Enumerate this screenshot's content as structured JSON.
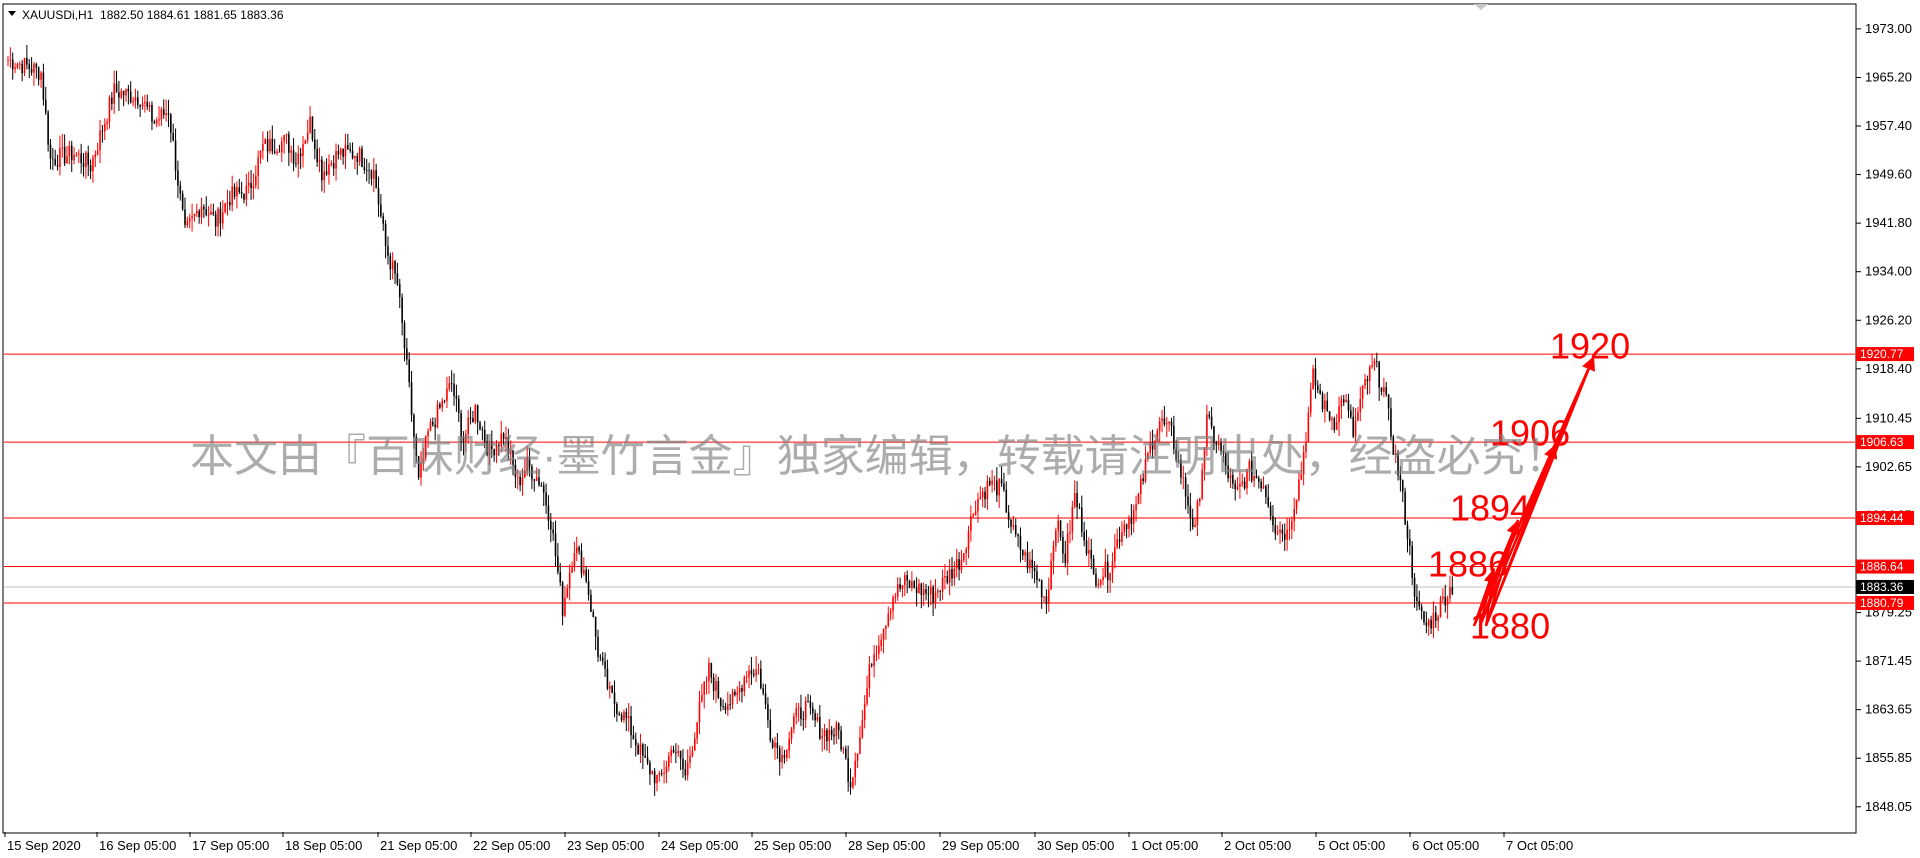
{
  "header": {
    "symbol_info": "XAUUSDi,H1  1882.50 1884.61 1881.65 1883.36",
    "dropdown_icon": "triangle-down-icon"
  },
  "watermark": "本文由『百味财经·墨竹言金』独家编辑，转载请注明出处，经盗必究！",
  "colors": {
    "bull_candle": "#ff0000",
    "bear_candle": "#000000",
    "level_line": "#ff0000",
    "annotation": "#ff0000",
    "price_tag": "#000000"
  },
  "chart_data": {
    "type": "candlestick",
    "timeframe": "H1",
    "ylim": [
      1844.0,
      1977.0
    ],
    "y_ticks": [
      "1973.00",
      "1965.20",
      "1957.40",
      "1949.60",
      "1941.80",
      "1934.00",
      "1926.20",
      "1918.40",
      "1910.45",
      "1902.65",
      "1894.85",
      "1879.25",
      "1871.45",
      "1863.65",
      "1855.85",
      "1848.05"
    ],
    "x_labels": [
      "15 Sep 2020",
      "16 Sep 05:00",
      "17 Sep 05:00",
      "18 Sep 05:00",
      "21 Sep 05:00",
      "22 Sep 05:00",
      "23 Sep 05:00",
      "24 Sep 05:00",
      "25 Sep 05:00",
      "28 Sep 05:00",
      "29 Sep 05:00",
      "30 Sep 05:00",
      "1 Oct 05:00",
      "2 Oct 05:00",
      "5 Oct 05:00",
      "6 Oct 05:00",
      "7 Oct 05:00"
    ],
    "current_price": "1883.36",
    "levels": [
      "1920.77",
      "1906.63",
      "1894.44",
      "1886.64",
      "1880.79"
    ],
    "annotations": [
      {
        "text": "1920",
        "price": 1922
      },
      {
        "text": "1906",
        "price": 1908
      },
      {
        "text": "1894",
        "price": 1896
      },
      {
        "text": "1886",
        "price": 1887
      },
      {
        "text": "1880",
        "price": 1877
      }
    ],
    "projection_arrows": [
      {
        "from_price": 1880.0,
        "to_price": 1920.77
      },
      {
        "from_price": 1880.0,
        "to_price": 1906.63
      },
      {
        "from_price": 1880.0,
        "to_price": 1894.44
      },
      {
        "from_price": 1880.0,
        "to_price": 1886.64
      }
    ],
    "keypoints": [
      {
        "t": 0,
        "p": 1968
      },
      {
        "t": 8,
        "p": 1967
      },
      {
        "t": 14,
        "p": 1966
      },
      {
        "t": 18,
        "p": 1952
      },
      {
        "t": 28,
        "p": 1953
      },
      {
        "t": 35,
        "p": 1951
      },
      {
        "t": 45,
        "p": 1963
      },
      {
        "t": 56,
        "p": 1962
      },
      {
        "t": 62,
        "p": 1958
      },
      {
        "t": 68,
        "p": 1960
      },
      {
        "t": 75,
        "p": 1940
      },
      {
        "t": 82,
        "p": 1945
      },
      {
        "t": 88,
        "p": 1942
      },
      {
        "t": 94,
        "p": 1946
      },
      {
        "t": 102,
        "p": 1947
      },
      {
        "t": 108,
        "p": 1954
      },
      {
        "t": 118,
        "p": 1955
      },
      {
        "t": 122,
        "p": 1952
      },
      {
        "t": 128,
        "p": 1958
      },
      {
        "t": 133,
        "p": 1950
      },
      {
        "t": 140,
        "p": 1953
      },
      {
        "t": 148,
        "p": 1953
      },
      {
        "t": 155,
        "p": 1950
      },
      {
        "t": 160,
        "p": 1938
      },
      {
        "t": 165,
        "p": 1932
      },
      {
        "t": 170,
        "p": 1915
      },
      {
        "t": 174,
        "p": 1900
      },
      {
        "t": 178,
        "p": 1908
      },
      {
        "t": 183,
        "p": 1912
      },
      {
        "t": 188,
        "p": 1916
      },
      {
        "t": 193,
        "p": 1907
      },
      {
        "t": 198,
        "p": 1912
      },
      {
        "t": 204,
        "p": 1905
      },
      {
        "t": 210,
        "p": 1908
      },
      {
        "t": 216,
        "p": 1900
      },
      {
        "t": 220,
        "p": 1903
      },
      {
        "t": 226,
        "p": 1900
      },
      {
        "t": 230,
        "p": 1894
      },
      {
        "t": 235,
        "p": 1880
      },
      {
        "t": 240,
        "p": 1890
      },
      {
        "t": 245,
        "p": 1885
      },
      {
        "t": 250,
        "p": 1873
      },
      {
        "t": 255,
        "p": 1866
      },
      {
        "t": 262,
        "p": 1862
      },
      {
        "t": 270,
        "p": 1855
      },
      {
        "t": 276,
        "p": 1852
      },
      {
        "t": 282,
        "p": 1858
      },
      {
        "t": 287,
        "p": 1853
      },
      {
        "t": 292,
        "p": 1862
      },
      {
        "t": 297,
        "p": 1870
      },
      {
        "t": 302,
        "p": 1865
      },
      {
        "t": 308,
        "p": 1865
      },
      {
        "t": 313,
        "p": 1870
      },
      {
        "t": 318,
        "p": 1870
      },
      {
        "t": 323,
        "p": 1860
      },
      {
        "t": 328,
        "p": 1856
      },
      {
        "t": 333,
        "p": 1862
      },
      {
        "t": 338,
        "p": 1864
      },
      {
        "t": 345,
        "p": 1860
      },
      {
        "t": 352,
        "p": 1860
      },
      {
        "t": 357,
        "p": 1852
      },
      {
        "t": 362,
        "p": 1862
      },
      {
        "t": 366,
        "p": 1872
      },
      {
        "t": 370,
        "p": 1876
      },
      {
        "t": 375,
        "p": 1882
      },
      {
        "t": 380,
        "p": 1884
      },
      {
        "t": 386,
        "p": 1883
      },
      {
        "t": 392,
        "p": 1882
      },
      {
        "t": 398,
        "p": 1885
      },
      {
        "t": 404,
        "p": 1888
      },
      {
        "t": 410,
        "p": 1897
      },
      {
        "t": 416,
        "p": 1900
      },
      {
        "t": 421,
        "p": 1899
      },
      {
        "t": 426,
        "p": 1892
      },
      {
        "t": 431,
        "p": 1888
      },
      {
        "t": 436,
        "p": 1885
      },
      {
        "t": 440,
        "p": 1881
      },
      {
        "t": 444,
        "p": 1894
      },
      {
        "t": 448,
        "p": 1888
      },
      {
        "t": 452,
        "p": 1898
      },
      {
        "t": 456,
        "p": 1892
      },
      {
        "t": 460,
        "p": 1885
      },
      {
        "t": 466,
        "p": 1886
      },
      {
        "t": 472,
        "p": 1893
      },
      {
        "t": 478,
        "p": 1896
      },
      {
        "t": 484,
        "p": 1906
      },
      {
        "t": 488,
        "p": 1910
      },
      {
        "t": 493,
        "p": 1908
      },
      {
        "t": 498,
        "p": 1900
      },
      {
        "t": 503,
        "p": 1892
      },
      {
        "t": 508,
        "p": 1910
      },
      {
        "t": 514,
        "p": 1905
      },
      {
        "t": 520,
        "p": 1898
      },
      {
        "t": 526,
        "p": 1902
      },
      {
        "t": 532,
        "p": 1900
      },
      {
        "t": 537,
        "p": 1893
      },
      {
        "t": 542,
        "p": 1892
      },
      {
        "t": 548,
        "p": 1902
      },
      {
        "t": 553,
        "p": 1917
      },
      {
        "t": 558,
        "p": 1912
      },
      {
        "t": 562,
        "p": 1910
      },
      {
        "t": 566,
        "p": 1914
      },
      {
        "t": 570,
        "p": 1908
      },
      {
        "t": 575,
        "p": 1916
      },
      {
        "t": 579,
        "p": 1919
      },
      {
        "t": 583,
        "p": 1915
      },
      {
        "t": 587,
        "p": 1906
      },
      {
        "t": 590,
        "p": 1900
      },
      {
        "t": 593,
        "p": 1892
      },
      {
        "t": 597,
        "p": 1880
      },
      {
        "t": 601,
        "p": 1877
      },
      {
        "t": 605,
        "p": 1879
      },
      {
        "t": 609,
        "p": 1882
      },
      {
        "t": 612,
        "p": 1883.4
      }
    ]
  }
}
